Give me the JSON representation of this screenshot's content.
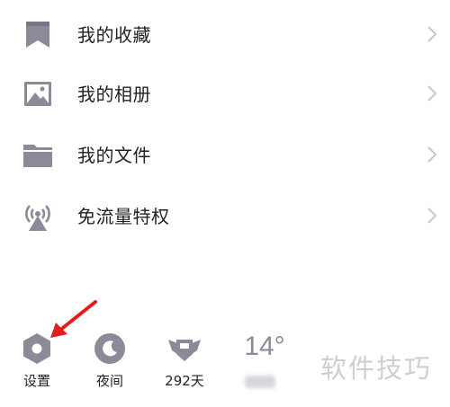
{
  "menu": {
    "items": [
      {
        "label": "我的收藏",
        "icon": "bookmark-icon"
      },
      {
        "label": "我的相册",
        "icon": "image-icon"
      },
      {
        "label": "我的文件",
        "icon": "folder-icon"
      },
      {
        "label": "免流量特权",
        "icon": "signal-tower-icon"
      }
    ]
  },
  "bottom_bar": {
    "settings_label": "设置",
    "night_label": "夜间",
    "days_label": "292天",
    "temperature": "14°"
  },
  "watermark": "软件技巧",
  "colors": {
    "icon_gray": "#8a8a99",
    "chevron": "#c7c7cc",
    "annotation_red": "#e11d1d"
  }
}
